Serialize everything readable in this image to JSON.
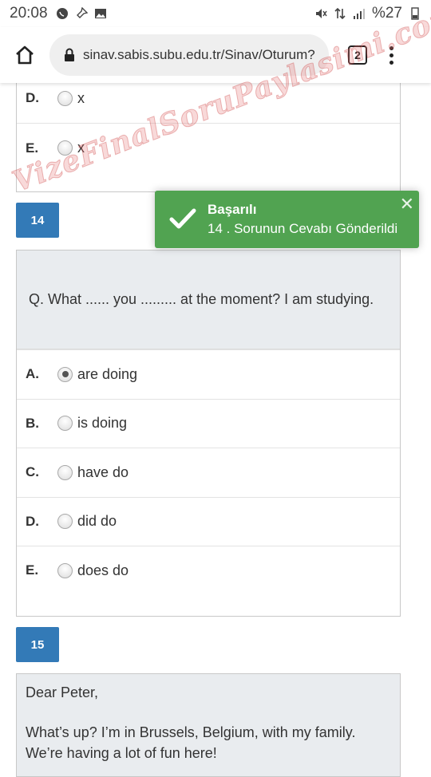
{
  "status_bar": {
    "time": "20:08",
    "battery": "%27"
  },
  "browser": {
    "url": "sinav.sabis.subu.edu.tr/Sinav/Oturum?",
    "tab_count": "2"
  },
  "prev_question": {
    "options": [
      {
        "letter": "D.",
        "text": "x",
        "checked": false
      },
      {
        "letter": "E.",
        "text": "x",
        "checked": false
      }
    ]
  },
  "question14": {
    "number": "14",
    "text": "Q. What ...... you ......... at the moment? I am studying.",
    "options": [
      {
        "letter": "A.",
        "text": "are doing",
        "checked": true
      },
      {
        "letter": "B.",
        "text": "is doing",
        "checked": false
      },
      {
        "letter": "C.",
        "text": "have do",
        "checked": false
      },
      {
        "letter": "D.",
        "text": "did do",
        "checked": false
      },
      {
        "letter": "E.",
        "text": "does do",
        "checked": false
      }
    ]
  },
  "toast": {
    "title": "Başarılı",
    "message": "14 . Sorunun Cevabı Gönderildi",
    "close": "✕"
  },
  "question15": {
    "number": "15",
    "greeting": "Dear Peter,",
    "line1": "What’s up? I’m in Brussels, Belgium, with my family.",
    "line2": "We’re having a lot of fun here!"
  },
  "watermark": "VizeFinalSoruPaylasimi.com",
  "colors": {
    "question_number_bg": "#337ab7",
    "toast_bg": "#51a351",
    "question_bg": "#e9ecef"
  }
}
